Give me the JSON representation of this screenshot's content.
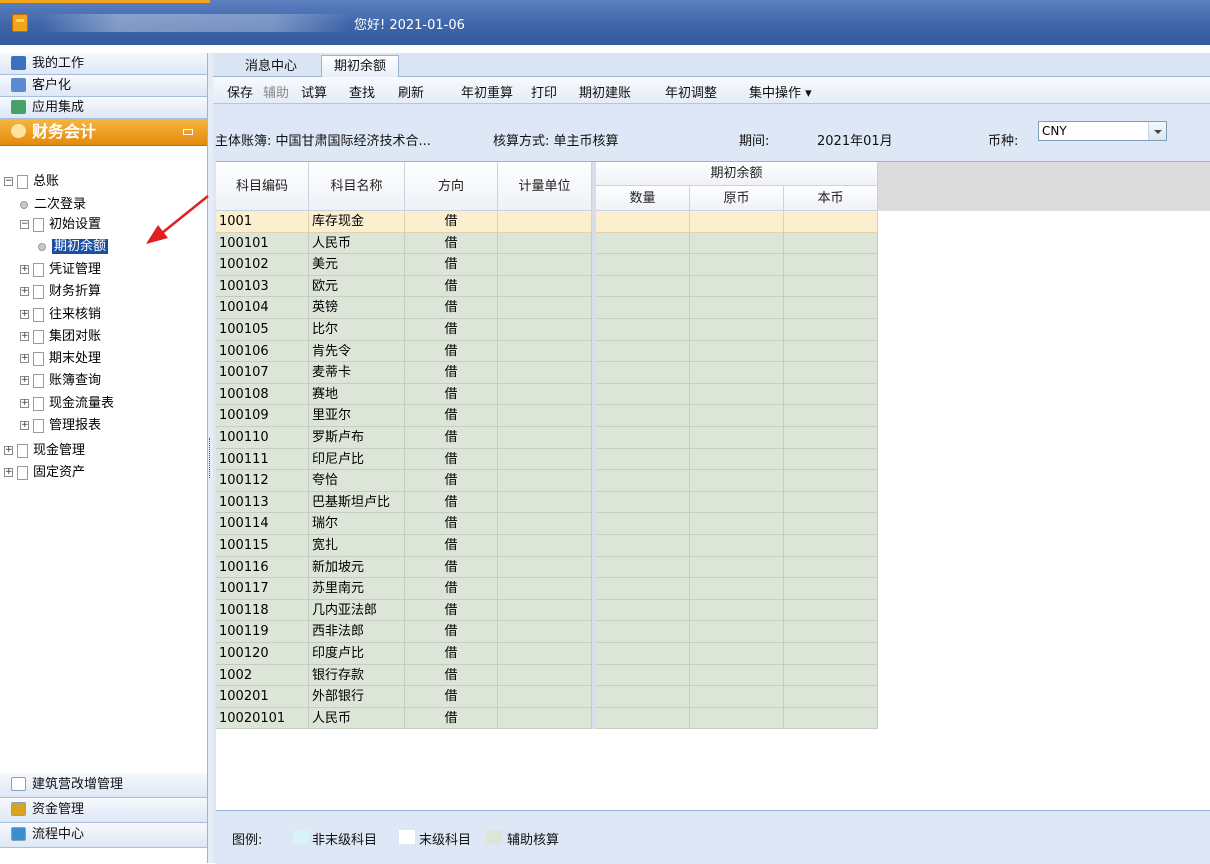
{
  "header": {
    "greeting": "您好! 2021-01-06"
  },
  "sidebar": {
    "modules": [
      {
        "label": "我的工作",
        "icon": "monitor-icon",
        "color": "#3a6fc2"
      },
      {
        "label": "客户化",
        "icon": "grid-icon",
        "color": "#5a8bd0"
      },
      {
        "label": "应用集成",
        "icon": "integration-icon",
        "color": "#4aa06a"
      }
    ],
    "active_module": {
      "label": "财务会计",
      "icon": "accounting-user-icon"
    },
    "tree": [
      {
        "label": "总账",
        "level": 0,
        "type": "folder",
        "expanded": true
      },
      {
        "label": "二次登录",
        "level": 1,
        "type": "leaf"
      },
      {
        "label": "初始设置",
        "level": 1,
        "type": "folder",
        "expanded": true
      },
      {
        "label": "期初余额",
        "level": 2,
        "type": "leaf",
        "selected": true
      },
      {
        "label": "凭证管理",
        "level": 1,
        "type": "folder",
        "expanded": false
      },
      {
        "label": "财务折算",
        "level": 1,
        "type": "folder",
        "expanded": false
      },
      {
        "label": "往来核销",
        "level": 1,
        "type": "folder",
        "expanded": false
      },
      {
        "label": "集团对账",
        "level": 1,
        "type": "folder",
        "expanded": false
      },
      {
        "label": "期末处理",
        "level": 1,
        "type": "folder",
        "expanded": false
      },
      {
        "label": "账簿查询",
        "level": 1,
        "type": "folder",
        "expanded": false
      },
      {
        "label": "现金流量表",
        "level": 1,
        "type": "folder",
        "expanded": false
      },
      {
        "label": "管理报表",
        "level": 1,
        "type": "folder",
        "expanded": false
      },
      {
        "label": "现金管理",
        "level": 0,
        "type": "folder",
        "expanded": false
      },
      {
        "label": "固定资产",
        "level": 0,
        "type": "folder",
        "expanded": false
      }
    ],
    "bottom_modules": [
      {
        "label": "建筑营改增管理",
        "icon": "document-icon"
      },
      {
        "label": "资金管理",
        "icon": "money-icon"
      },
      {
        "label": "流程中心",
        "icon": "workflow-icon"
      }
    ]
  },
  "tabs": [
    {
      "label": "消息中心",
      "active": false
    },
    {
      "label": "期初余额",
      "active": true
    }
  ],
  "toolbar": {
    "buttons": [
      {
        "label": "保存",
        "enabled": true
      },
      {
        "label": "辅助",
        "enabled": false
      },
      {
        "label": "试算",
        "enabled": true
      },
      {
        "label": "查找",
        "enabled": true
      },
      {
        "label": "刷新",
        "enabled": true
      },
      {
        "label": "年初重算",
        "enabled": true
      },
      {
        "label": "打印",
        "enabled": true
      },
      {
        "label": "期初建账",
        "enabled": true
      },
      {
        "label": "年初调整",
        "enabled": true
      },
      {
        "label": "集中操作 ▾",
        "enabled": true
      }
    ]
  },
  "info": {
    "book": "主体账簿: 中国甘肃国际经济技术合...",
    "method": "核算方式: 单主币核算",
    "period_label": "期间:",
    "period_value": "2021年01月",
    "currency_label": "币种:",
    "currency_value": "CNY"
  },
  "grid": {
    "columns": [
      "科目编码",
      "科目名称",
      "方向",
      "计量单位"
    ],
    "group_header": "期初余额",
    "sub_columns": [
      "数量",
      "原币",
      "本币"
    ],
    "rows": [
      [
        "1001",
        "库存现金",
        "借"
      ],
      [
        "100101",
        "人民币",
        "借"
      ],
      [
        "100102",
        "美元",
        "借"
      ],
      [
        "100103",
        "欧元",
        "借"
      ],
      [
        "100104",
        "英镑",
        "借"
      ],
      [
        "100105",
        "比尔",
        "借"
      ],
      [
        "100106",
        "肯先令",
        "借"
      ],
      [
        "100107",
        "麦蒂卡",
        "借"
      ],
      [
        "100108",
        "赛地",
        "借"
      ],
      [
        "100109",
        "里亚尔",
        "借"
      ],
      [
        "100110",
        "罗斯卢布",
        "借"
      ],
      [
        "100111",
        "印尼卢比",
        "借"
      ],
      [
        "100112",
        "夸恰",
        "借"
      ],
      [
        "100113",
        "巴基斯坦卢比",
        "借"
      ],
      [
        "100114",
        "瑞尔",
        "借"
      ],
      [
        "100115",
        "宽扎",
        "借"
      ],
      [
        "100116",
        "新加坡元",
        "借"
      ],
      [
        "100117",
        "苏里南元",
        "借"
      ],
      [
        "100118",
        "几内亚法郎",
        "借"
      ],
      [
        "100119",
        "西非法郎",
        "借"
      ],
      [
        "100120",
        "印度卢比",
        "借"
      ],
      [
        "1002",
        "银行存款",
        "借"
      ],
      [
        "100201",
        "外部银行",
        "借"
      ],
      [
        "10020101",
        "人民币",
        "借"
      ]
    ],
    "highlighted_row": 0
  },
  "legend": {
    "title": "图例:",
    "items": [
      {
        "label": "非末级科目",
        "color": "#d6f3f8"
      },
      {
        "label": "末级科目",
        "color": "#ffffff"
      },
      {
        "label": "辅助核算",
        "color": "#dde5d8"
      }
    ]
  },
  "colors": {
    "accent": "#e48a0c",
    "header_blue": "#3f66aa",
    "selection": "#1c4fa3",
    "annotation": "#e02020"
  }
}
